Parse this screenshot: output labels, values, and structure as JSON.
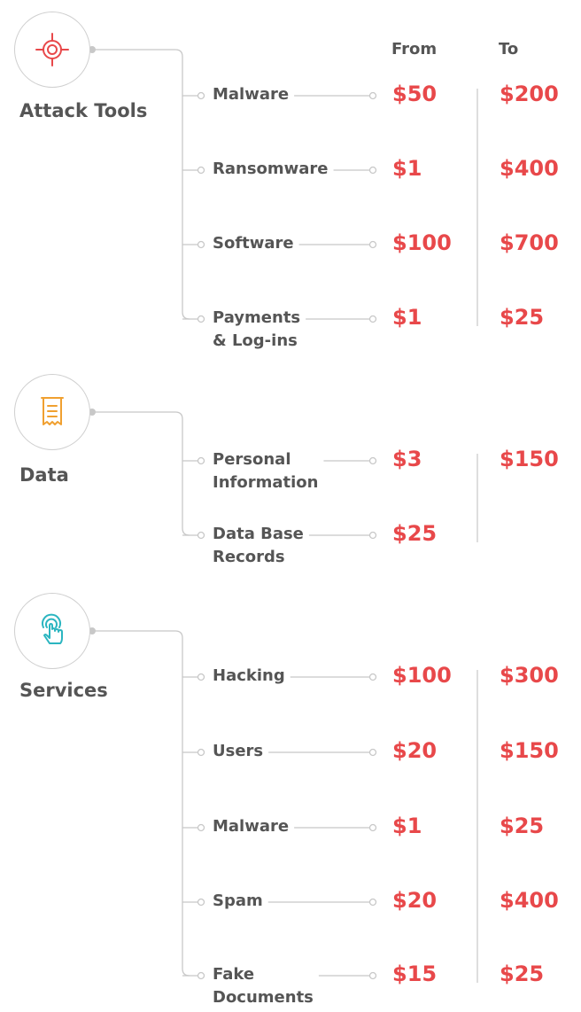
{
  "header": {
    "from_label": "From",
    "to_label": "To"
  },
  "categories": [
    {
      "name": "Attack Tools",
      "icon": "crosshair-icon",
      "icon_color": "#e8484a",
      "items": [
        {
          "label_line1": "Malware",
          "label_line2": "",
          "from": "$50",
          "to": "$200"
        },
        {
          "label_line1": "Ransomware",
          "label_line2": "",
          "from": "$1",
          "to": "$400"
        },
        {
          "label_line1": "Software",
          "label_line2": "",
          "from": "$100",
          "to": "$700"
        },
        {
          "label_line1": "Payments",
          "label_line2": "& Log-ins",
          "from": "$1",
          "to": "$25"
        }
      ]
    },
    {
      "name": "Data",
      "icon": "receipt-icon",
      "icon_color": "#f0a030",
      "items": [
        {
          "label_line1": "Personal",
          "label_line2": "Information",
          "from": "$3",
          "to": "$150"
        },
        {
          "label_line1": "Data Base",
          "label_line2": "Records",
          "from": "$25",
          "to": ""
        }
      ]
    },
    {
      "name": "Services",
      "icon": "touch-icon",
      "icon_color": "#2bb5c0",
      "items": [
        {
          "label_line1": "Hacking",
          "label_line2": "",
          "from": "$100",
          "to": "$300"
        },
        {
          "label_line1": "Users",
          "label_line2": "",
          "from": "$20",
          "to": "$150"
        },
        {
          "label_line1": "Malware",
          "label_line2": "",
          "from": "$1",
          "to": "$25"
        },
        {
          "label_line1": "Spam",
          "label_line2": "",
          "from": "$20",
          "to": "$400"
        },
        {
          "label_line1": "Fake",
          "label_line2": "Documents",
          "from": "$15",
          "to": "$25"
        }
      ]
    }
  ],
  "colors": {
    "price": "#e8484a",
    "text": "#555555",
    "line": "#c8c8c8"
  }
}
